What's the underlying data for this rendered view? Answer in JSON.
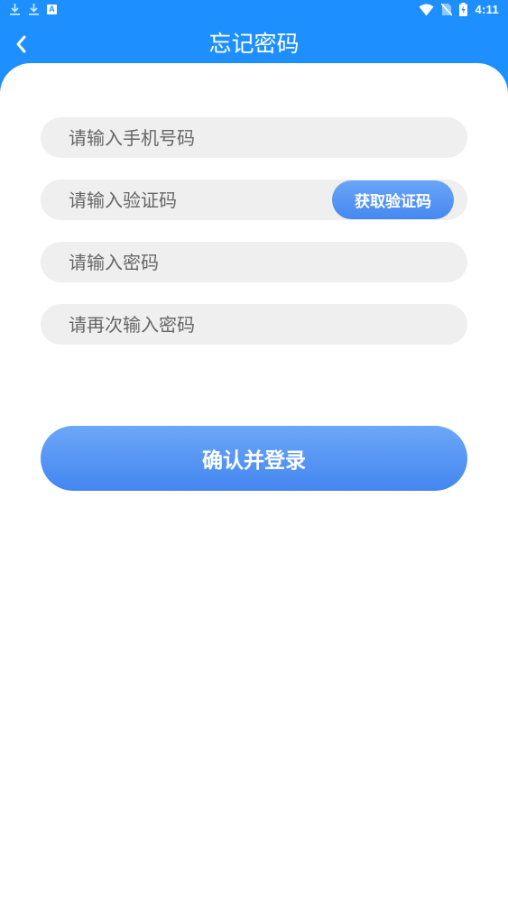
{
  "status_bar": {
    "time": "4:11",
    "left_icons": [
      "download-icon",
      "download-icon",
      "a-badge-icon"
    ],
    "a_badge_label": "A",
    "right_icons": [
      "wifi-icon",
      "no-sim-icon",
      "battery-charging-icon"
    ]
  },
  "header": {
    "title": "忘记密码",
    "back_icon": "chevron-left-icon"
  },
  "form": {
    "phone_placeholder": "请输入手机号码",
    "code_placeholder": "请输入验证码",
    "get_code_label": "获取验证码",
    "password_placeholder": "请输入密码",
    "confirm_password_placeholder": "请再次输入密码",
    "submit_label": "确认并登录"
  },
  "colors": {
    "primary": "#1E8FFF",
    "button_gradient_top": "#6CA7F9",
    "button_gradient_bottom": "#4386F0",
    "field_background": "#EFEFEF"
  }
}
